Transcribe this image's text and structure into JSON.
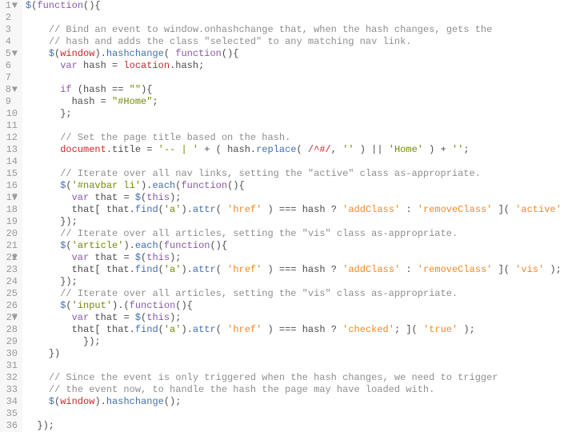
{
  "lines": [
    {
      "n": 1,
      "fold": "▼",
      "indent": 0,
      "tokens": [
        [
          "fn",
          "$"
        ],
        [
          "punct",
          "("
        ],
        [
          "kw",
          "function"
        ],
        [
          "punct",
          "(){"
        ]
      ]
    },
    {
      "n": 2,
      "indent": 1,
      "tokens": []
    },
    {
      "n": 3,
      "indent": 2,
      "tokens": [
        [
          "comment",
          "// Bind an event to window.onhashchange that, when the hash changes, gets the"
        ]
      ]
    },
    {
      "n": 4,
      "indent": 2,
      "tokens": [
        [
          "comment",
          "// hash and adds the class \"selected\" to any matching nav link."
        ]
      ]
    },
    {
      "n": 5,
      "fold": "▼",
      "indent": 2,
      "tokens": [
        [
          "fn",
          "$"
        ],
        [
          "punct",
          "("
        ],
        [
          "obj",
          "window"
        ],
        [
          "punct",
          ")."
        ],
        [
          "fn",
          "hashchange"
        ],
        [
          "punct",
          "( "
        ],
        [
          "kw",
          "function"
        ],
        [
          "punct",
          "(){"
        ]
      ]
    },
    {
      "n": 6,
      "indent": 3,
      "tokens": [
        [
          "kw",
          "var"
        ],
        [
          "punct",
          " "
        ],
        [
          "ident",
          "hash "
        ],
        [
          "punct",
          "= "
        ],
        [
          "obj",
          "location"
        ],
        [
          "punct",
          "."
        ],
        [
          "ident",
          "hash"
        ],
        [
          "punct",
          ";"
        ]
      ]
    },
    {
      "n": 7,
      "indent": 3,
      "tokens": []
    },
    {
      "n": 8,
      "fold": "▼",
      "indent": 3,
      "tokens": [
        [
          "kw",
          "if"
        ],
        [
          "punct",
          " (hash "
        ],
        [
          "punct",
          "== "
        ],
        [
          "str",
          "\"\""
        ],
        [
          "punct",
          "){"
        ]
      ]
    },
    {
      "n": 9,
      "indent": 4,
      "tokens": [
        [
          "ident",
          "hash "
        ],
        [
          "punct",
          "= "
        ],
        [
          "str",
          "\"#Home\""
        ],
        [
          "punct",
          ";"
        ]
      ]
    },
    {
      "n": 10,
      "indent": 3,
      "tokens": [
        [
          "punct",
          "};"
        ]
      ]
    },
    {
      "n": 11,
      "indent": 3,
      "tokens": []
    },
    {
      "n": 12,
      "indent": 3,
      "tokens": [
        [
          "comment",
          "// Set the page title based on the hash."
        ]
      ]
    },
    {
      "n": 13,
      "indent": 3,
      "tokens": [
        [
          "obj",
          "document"
        ],
        [
          "punct",
          "."
        ],
        [
          "ident",
          "title "
        ],
        [
          "punct",
          "= "
        ],
        [
          "str",
          "'-- | '"
        ],
        [
          "punct",
          " + ( hash."
        ],
        [
          "fn",
          "replace"
        ],
        [
          "punct",
          "( "
        ],
        [
          "regex",
          "/^#/"
        ],
        [
          "punct",
          ", "
        ],
        [
          "str",
          "''"
        ],
        [
          "punct",
          " ) || "
        ],
        [
          "str",
          "'Home'"
        ],
        [
          "punct",
          " ) + "
        ],
        [
          "str",
          "''"
        ],
        [
          "punct",
          ";"
        ]
      ]
    },
    {
      "n": 14,
      "indent": 3,
      "tokens": []
    },
    {
      "n": 15,
      "indent": 3,
      "tokens": [
        [
          "comment",
          "// Iterate over all nav links, setting the \"active\" class as-appropriate."
        ]
      ]
    },
    {
      "n": 16,
      "fold": "▼",
      "indent": 3,
      "tokens": [
        [
          "fn",
          "$"
        ],
        [
          "punct",
          "("
        ],
        [
          "str",
          "'#navbar li'"
        ],
        [
          "punct",
          ")."
        ],
        [
          "fn",
          "each"
        ],
        [
          "punct",
          "("
        ],
        [
          "kw",
          "function"
        ],
        [
          "punct",
          "(){"
        ]
      ]
    },
    {
      "n": 17,
      "indent": 4,
      "tokens": [
        [
          "kw",
          "var"
        ],
        [
          "punct",
          " "
        ],
        [
          "ident",
          "that "
        ],
        [
          "punct",
          "= "
        ],
        [
          "fn",
          "$"
        ],
        [
          "punct",
          "("
        ],
        [
          "kw",
          "this"
        ],
        [
          "punct",
          ");"
        ]
      ]
    },
    {
      "n": 18,
      "indent": 4,
      "tokens": [
        [
          "ident",
          "that"
        ],
        [
          "punct",
          "[ that."
        ],
        [
          "fn",
          "find"
        ],
        [
          "punct",
          "("
        ],
        [
          "str",
          "'a'"
        ],
        [
          "punct",
          ")."
        ],
        [
          "fn",
          "attr"
        ],
        [
          "punct",
          "( "
        ],
        [
          "str2",
          "'href'"
        ],
        [
          "punct",
          " ) === hash ? "
        ],
        [
          "str2",
          "'addClass'"
        ],
        [
          "punct",
          " : "
        ],
        [
          "str2",
          "'removeClass'"
        ],
        [
          "punct",
          " ]( "
        ],
        [
          "str2",
          "'active'"
        ],
        [
          "punct",
          " );"
        ]
      ]
    },
    {
      "n": 19,
      "indent": 3,
      "tokens": [
        [
          "punct",
          "});"
        ]
      ]
    },
    {
      "n": 20,
      "indent": 3,
      "tokens": [
        [
          "comment",
          "// Iterate over all articles, setting the \"vis\" class as-appropriate."
        ]
      ]
    },
    {
      "n": 21,
      "fold": "▼",
      "indent": 3,
      "tokens": [
        [
          "fn",
          "$"
        ],
        [
          "punct",
          "("
        ],
        [
          "str",
          "'article'"
        ],
        [
          "punct",
          ")."
        ],
        [
          "fn",
          "each"
        ],
        [
          "punct",
          "("
        ],
        [
          "kw",
          "function"
        ],
        [
          "punct",
          "(){"
        ]
      ]
    },
    {
      "n": 22,
      "indent": 4,
      "tokens": [
        [
          "kw",
          "var"
        ],
        [
          "punct",
          " "
        ],
        [
          "ident",
          "that "
        ],
        [
          "punct",
          "= "
        ],
        [
          "fn",
          "$"
        ],
        [
          "punct",
          "("
        ],
        [
          "kw",
          "this"
        ],
        [
          "punct",
          ");"
        ]
      ]
    },
    {
      "n": 23,
      "indent": 4,
      "tokens": [
        [
          "ident",
          "that"
        ],
        [
          "punct",
          "[ that."
        ],
        [
          "fn",
          "find"
        ],
        [
          "punct",
          "("
        ],
        [
          "str",
          "'a'"
        ],
        [
          "punct",
          ")."
        ],
        [
          "fn",
          "attr"
        ],
        [
          "punct",
          "( "
        ],
        [
          "str2",
          "'href'"
        ],
        [
          "punct",
          " ) === hash ? "
        ],
        [
          "str2",
          "'addClass'"
        ],
        [
          "punct",
          " : "
        ],
        [
          "str2",
          "'removeClass'"
        ],
        [
          "punct",
          " ]( "
        ],
        [
          "str2",
          "'vis'"
        ],
        [
          "punct",
          " );"
        ]
      ]
    },
    {
      "n": 24,
      "indent": 3,
      "tokens": [
        [
          "punct",
          "});"
        ]
      ]
    },
    {
      "n": 25,
      "indent": 3,
      "tokens": [
        [
          "comment",
          "// Iterate over all articles, setting the \"vis\" class as-appropriate."
        ]
      ]
    },
    {
      "n": 26,
      "fold": "▼",
      "indent": 3,
      "tokens": [
        [
          "fn",
          "$"
        ],
        [
          "punct",
          "("
        ],
        [
          "str",
          "'input'"
        ],
        [
          "punct",
          ").("
        ],
        [
          "kw",
          "function"
        ],
        [
          "punct",
          "(){"
        ]
      ]
    },
    {
      "n": 27,
      "indent": 4,
      "tokens": [
        [
          "kw",
          "var"
        ],
        [
          "punct",
          " "
        ],
        [
          "ident",
          "that "
        ],
        [
          "punct",
          "= "
        ],
        [
          "fn",
          "$"
        ],
        [
          "punct",
          "("
        ],
        [
          "kw",
          "this"
        ],
        [
          "punct",
          ");"
        ]
      ]
    },
    {
      "n": 28,
      "indent": 4,
      "tokens": [
        [
          "ident",
          "that"
        ],
        [
          "punct",
          "[ that."
        ],
        [
          "fn",
          "find"
        ],
        [
          "punct",
          "("
        ],
        [
          "str",
          "'a'"
        ],
        [
          "punct",
          ")."
        ],
        [
          "fn",
          "attr"
        ],
        [
          "punct",
          "( "
        ],
        [
          "str2",
          "'href'"
        ],
        [
          "punct",
          " ) === hash ? "
        ],
        [
          "str2",
          "'checked'"
        ],
        [
          "punct",
          "; ]( "
        ],
        [
          "str2",
          "'true'"
        ],
        [
          "punct",
          " );"
        ]
      ]
    },
    {
      "n": 29,
      "indent": 5,
      "tokens": [
        [
          "punct",
          "});"
        ]
      ]
    },
    {
      "n": 30,
      "indent": 2,
      "tokens": [
        [
          "punct",
          "})"
        ]
      ]
    },
    {
      "n": 31,
      "indent": 2,
      "tokens": []
    },
    {
      "n": 32,
      "indent": 2,
      "tokens": [
        [
          "comment",
          "// Since the event is only triggered when the hash changes, we need to trigger"
        ]
      ]
    },
    {
      "n": 33,
      "indent": 2,
      "tokens": [
        [
          "comment",
          "// the event now, to handle the hash the page may have loaded with."
        ]
      ]
    },
    {
      "n": 34,
      "indent": 2,
      "tokens": [
        [
          "fn",
          "$"
        ],
        [
          "punct",
          "("
        ],
        [
          "obj",
          "window"
        ],
        [
          "punct",
          ")."
        ],
        [
          "fn",
          "hashchange"
        ],
        [
          "punct",
          "();"
        ]
      ]
    },
    {
      "n": 35,
      "indent": 2,
      "tokens": []
    },
    {
      "n": 36,
      "indent": 1,
      "tokens": [
        [
          "punct",
          "});"
        ]
      ]
    }
  ]
}
